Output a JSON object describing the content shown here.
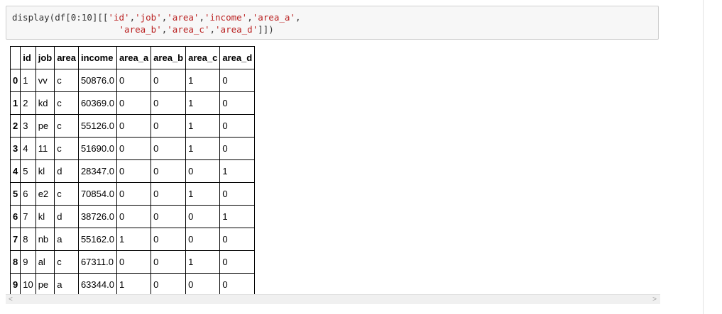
{
  "input": {
    "line1": [
      "display(df[0:10][[",
      "'id'",
      ",",
      "'job'",
      ",",
      "'area'",
      ",",
      "'income'",
      ",",
      "'area_a'",
      ","
    ],
    "line2": [
      "                    ",
      "'area_b'",
      ",",
      "'area_c'",
      ",",
      "'area_d'",
      "]])"
    ]
  },
  "table": {
    "columns": [
      "",
      "id",
      "job",
      "area",
      "income",
      "area_a",
      "area_b",
      "area_c",
      "area_d"
    ],
    "rows": [
      [
        "0",
        "1",
        "vv",
        "c",
        "50876.0",
        "0",
        "0",
        "1",
        "0"
      ],
      [
        "1",
        "2",
        "kd",
        "c",
        "60369.0",
        "0",
        "0",
        "1",
        "0"
      ],
      [
        "2",
        "3",
        "pe",
        "c",
        "55126.0",
        "0",
        "0",
        "1",
        "0"
      ],
      [
        "3",
        "4",
        "11",
        "c",
        "51690.0",
        "0",
        "0",
        "1",
        "0"
      ],
      [
        "4",
        "5",
        "kl",
        "d",
        "28347.0",
        "0",
        "0",
        "0",
        "1"
      ],
      [
        "5",
        "6",
        "e2",
        "c",
        "70854.0",
        "0",
        "0",
        "1",
        "0"
      ],
      [
        "6",
        "7",
        "kl",
        "d",
        "38726.0",
        "0",
        "0",
        "0",
        "1"
      ],
      [
        "7",
        "8",
        "nb",
        "a",
        "55162.0",
        "1",
        "0",
        "0",
        "0"
      ],
      [
        "8",
        "9",
        "al",
        "c",
        "67311.0",
        "0",
        "0",
        "1",
        "0"
      ],
      [
        "9",
        "10",
        "pe",
        "a",
        "63344.0",
        "1",
        "0",
        "0",
        "0"
      ]
    ]
  },
  "scrollbar": {
    "left_arrow": "<",
    "right_arrow": ">"
  }
}
